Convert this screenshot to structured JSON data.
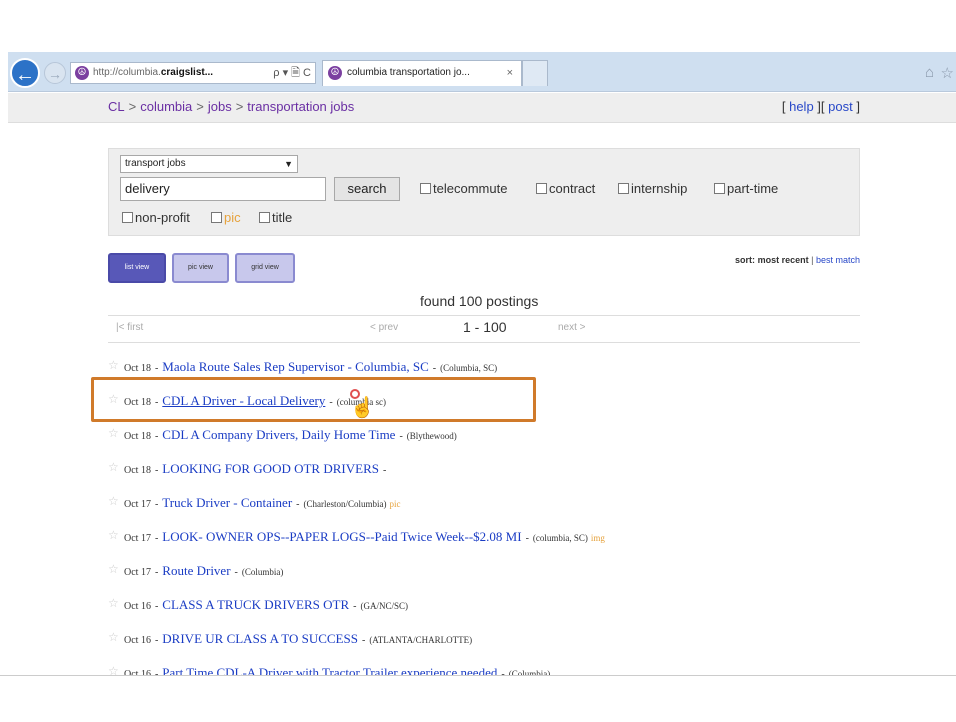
{
  "browser": {
    "url_prefix": "http://columbia.",
    "url_host": "craigslist...",
    "url_tools": "ρ ▾ 🗎 C",
    "tab_title": "columbia transportation jo...",
    "tab_close": "×",
    "back_glyph": "←",
    "forward_glyph": "→",
    "home_glyph": "⌂",
    "fav_glyph": "☆",
    "site_icon_glyph": "☮"
  },
  "header": {
    "breadcrumb": [
      "CL",
      "columbia",
      "jobs",
      "transportation jobs"
    ],
    "separator": ">",
    "help": "help",
    "post": "post",
    "bracket_open": "[",
    "bracket_close": "]"
  },
  "search": {
    "category": "transport jobs",
    "query": "delivery",
    "button": "search",
    "filters": {
      "telecommute": "telecommute",
      "contract": "contract",
      "internship": "internship",
      "part_time": "part-time",
      "non_profit": "non-profit",
      "pic": "pic",
      "title": "title"
    }
  },
  "views": {
    "list": "list view",
    "pic": "pic view",
    "grid": "grid view",
    "active": "list"
  },
  "sort": {
    "label": "sort:",
    "active": "most recent",
    "divider": "|",
    "other": "best match"
  },
  "results": {
    "found": "found 100 postings",
    "first": "|< first",
    "prev": "< prev",
    "range": "1 - 100",
    "next": "next >"
  },
  "listings": [
    {
      "date": "Oct 18",
      "title": "Maola Route Sales Rep Supervisor - Columbia, SC",
      "hood": "(Columbia, SC)",
      "pic": ""
    },
    {
      "date": "Oct 18",
      "title": "CDL A Driver - Local Delivery",
      "hood": "(columbia sc)",
      "pic": ""
    },
    {
      "date": "Oct 18",
      "title": "CDL A Company Drivers, Daily Home Time",
      "hood": "(Blythewood)",
      "pic": ""
    },
    {
      "date": "Oct 18",
      "title": "LOOKING FOR GOOD OTR DRIVERS",
      "hood": "",
      "pic": ""
    },
    {
      "date": "Oct 17",
      "title": "Truck Driver - Container",
      "hood": "(Charleston/Columbia)",
      "pic": "pic"
    },
    {
      "date": "Oct 17",
      "title": "LOOK- OWNER OPS--PAPER LOGS--Paid Twice Week--$2.08 MI",
      "hood": "(columbia, SC)",
      "pic": "img"
    },
    {
      "date": "Oct 17",
      "title": "Route Driver",
      "hood": "(Columbia)",
      "pic": ""
    },
    {
      "date": "Oct 16",
      "title": "CLASS A TRUCK DRIVERS OTR",
      "hood": "(GA/NC/SC)",
      "pic": ""
    },
    {
      "date": "Oct 16",
      "title": "DRIVE UR CLASS A TO SUCCESS",
      "hood": "(ATLANTA/CHARLOTTE)",
      "pic": ""
    },
    {
      "date": "Oct 16",
      "title": "Part Time CDL-A Driver with Tractor Trailer experience needed",
      "hood": "(Columbia)",
      "pic": ""
    }
  ],
  "row_glyphs": {
    "star": "☆",
    "dash": "-"
  },
  "colors": {
    "accent_highlight": "#d07a2a",
    "link": "#1a3cc4",
    "visited": "#6a2fa3",
    "browser_chrome": "#cfdff0"
  }
}
